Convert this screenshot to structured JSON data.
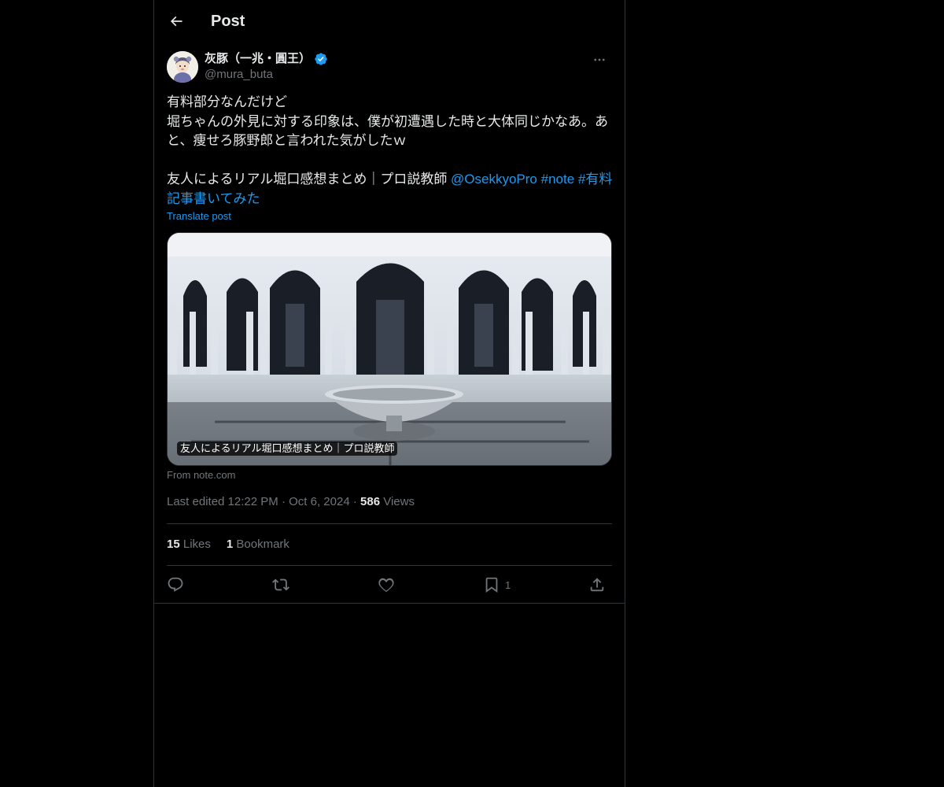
{
  "header": {
    "title": "Post"
  },
  "author": {
    "name": "灰豚（一兆・圓王）",
    "handle": "@mura_buta"
  },
  "post": {
    "text_line1": "有料部分なんだけど",
    "text_line2": "堀ちゃんの外見に対する印象は、僕が初遭遇した時と大体同じかなあ。あと、痩せろ豚野郎と言われた気がしたｗ",
    "text_line3_prefix": "友人によるリアル堀口感想まとめ｜プロ説教師 ",
    "mention": "@OsekkyoPro",
    "hashtag1": "#note",
    "hashtag2": "#有料記事書いてみた",
    "translate_label": "Translate post"
  },
  "card": {
    "caption": "友人によるリアル堀口感想まとめ｜プロ説教師",
    "source": "From note.com"
  },
  "meta": {
    "edited_label": "Last edited 12:22 PM",
    "date": "Oct 6, 2024",
    "views_count": "586",
    "views_label": "Views"
  },
  "stats": {
    "likes_count": "15",
    "likes_label": "Likes",
    "bookmarks_count": "1",
    "bookmarks_label": "Bookmark"
  },
  "actions": {
    "bookmark_count": "1"
  },
  "colors": {
    "background": "#000000",
    "text": "#e7e9ea",
    "muted": "#71767b",
    "accent": "#1d9bf0",
    "border": "#2f3336"
  }
}
